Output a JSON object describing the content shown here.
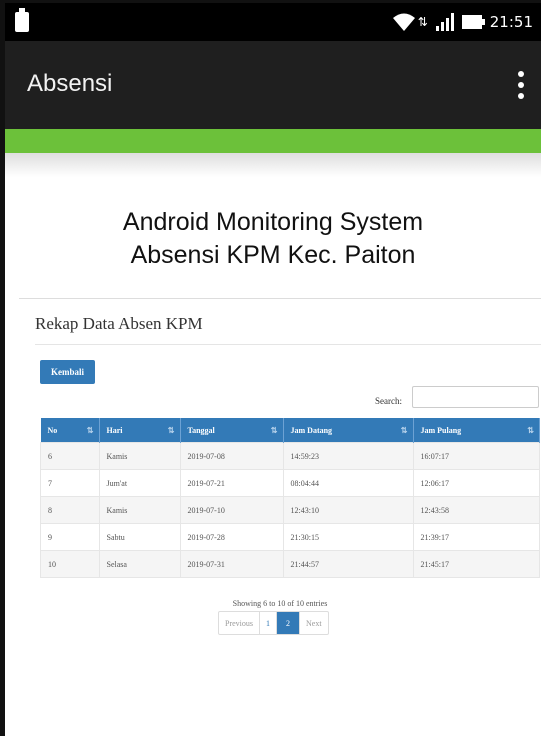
{
  "status_bar": {
    "time": "21:51"
  },
  "app_bar": {
    "title": "Absensi",
    "menu_icon": "overflow-menu-icon"
  },
  "banner": {
    "line1": "Android Monitoring System",
    "line2": "Absensi  KPM Kec. Paiton"
  },
  "panel": {
    "title": "Rekap Data Absen KPM",
    "back_button": "Kembali",
    "search_label": "Search:",
    "search_value": ""
  },
  "table": {
    "columns": [
      "No",
      "Hari",
      "Tanggal",
      "Jam Datang",
      "Jam Pulang"
    ],
    "rows": [
      [
        "6",
        "Kamis",
        "2019-07-08",
        "14:59:23",
        "16:07:17"
      ],
      [
        "7",
        "Jum'at",
        "2019-07-21",
        "08:04:44",
        "12:06:17"
      ],
      [
        "8",
        "Kamis",
        "2019-07-10",
        "12:43:10",
        "12:43:58"
      ],
      [
        "9",
        "Sabtu",
        "2019-07-28",
        "21:30:15",
        "21:39:17"
      ],
      [
        "10",
        "Selasa",
        "2019-07-31",
        "21:44:57",
        "21:45:17"
      ]
    ]
  },
  "footer": {
    "info": "Showing 6 to 10 of 10 entries",
    "previous": "Previous",
    "pages": [
      "1",
      "2"
    ],
    "active_page": "2",
    "next": "Next"
  },
  "colors": {
    "app_bar": "#1f1f1f",
    "accent_green": "#6cc13a",
    "primary_blue": "#337ab7"
  }
}
